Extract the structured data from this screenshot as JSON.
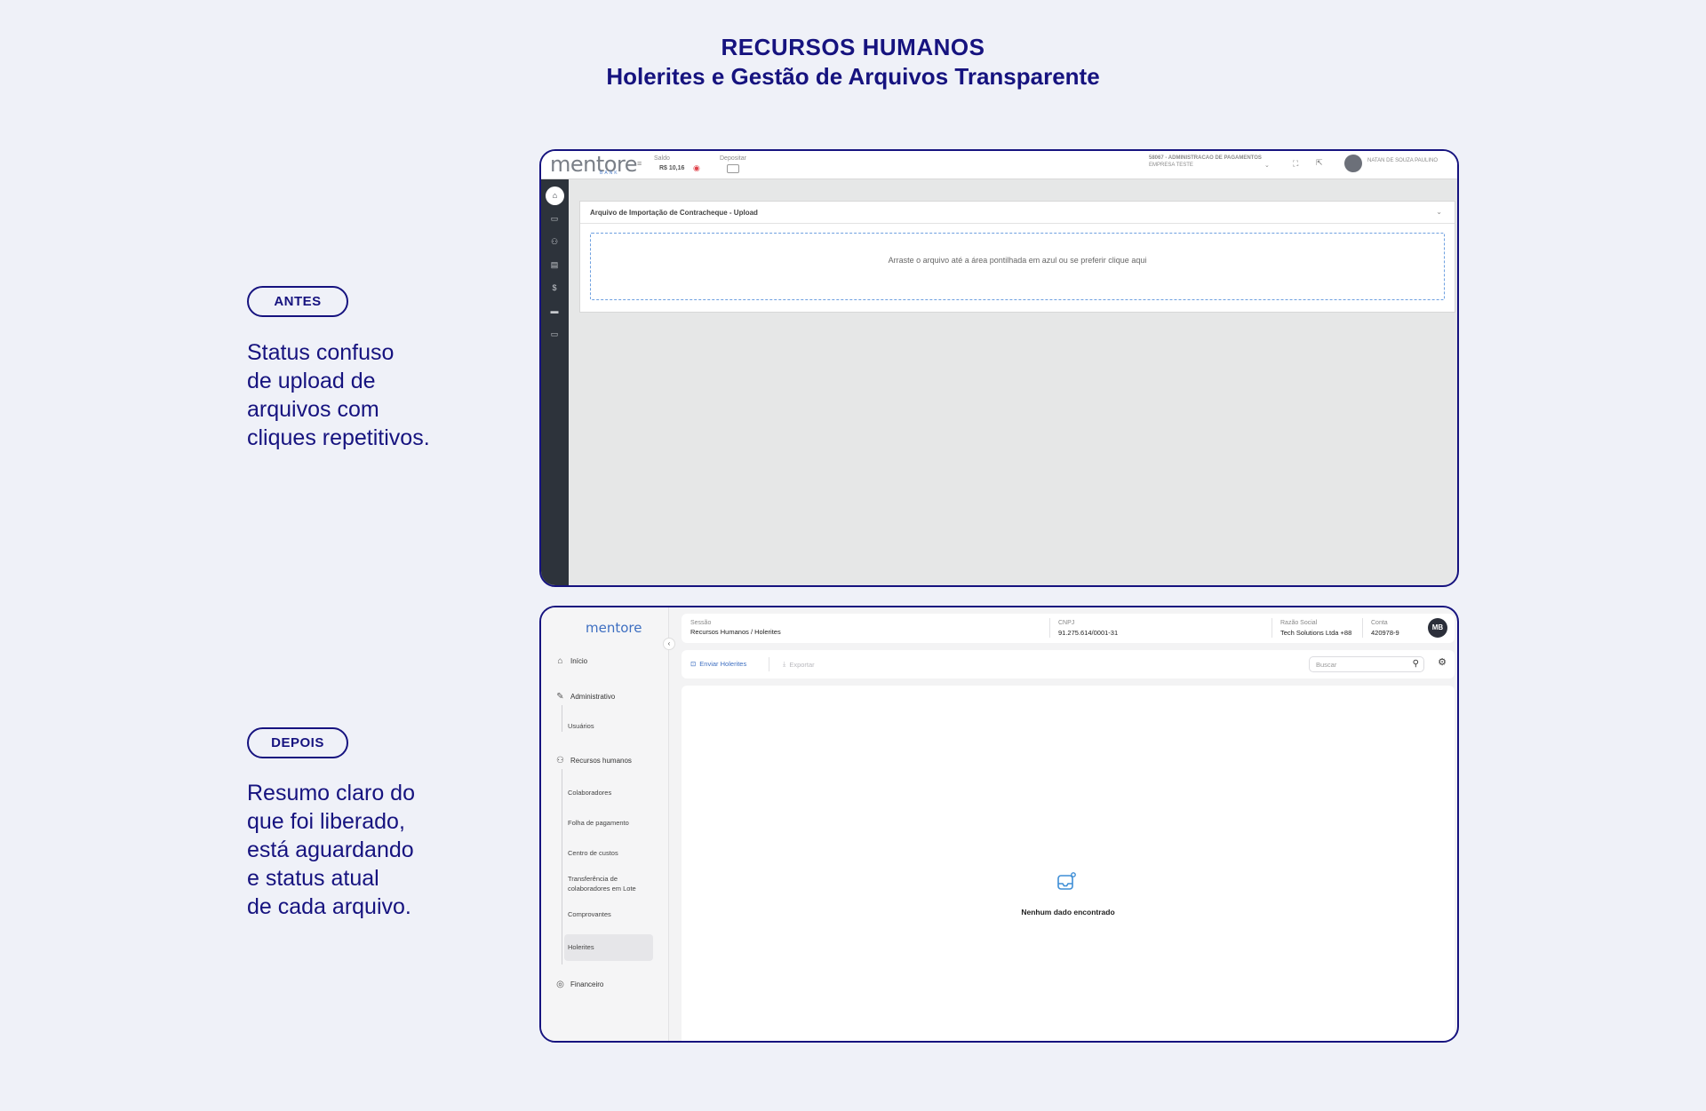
{
  "heading": {
    "title": "RECURSOS HUMANOS",
    "subtitle": "Holerites e Gestão de Arquivos Transparente"
  },
  "before": {
    "pill": "ANTES",
    "description": "Status confuso\nde upload de\narquivos com\ncliques repetitivos.",
    "screen": {
      "logo": "mentore",
      "logo_sub": "BANK",
      "saldo_label": "Saldo",
      "saldo_value": "R$ 10,16",
      "depositar_label": "Depositar",
      "company_line1": "58067 - ADMINISTRACAO DE PAGAMENTOS",
      "company_line2": "EMPRESA TESTE",
      "user_name": "NATAN DE SOUZA PAULINO",
      "card_title": "Arquivo de Importação de Contracheque - Upload",
      "dropzone_text": "Arraste o arquivo até a área pontilhada em azul ou se preferir clique aqui"
    }
  },
  "after": {
    "pill": "DEPOIS",
    "description": "Resumo claro do\nque foi liberado,\nestá aguardando\ne status atual\nde cada arquivo.",
    "screen": {
      "logo": "mentore",
      "nav": {
        "inicio": "Início",
        "administrativo": "Administrativo",
        "usuarios": "Usuários",
        "rh": "Recursos humanos",
        "colaboradores": "Colaboradores",
        "folha": "Folha de pagamento",
        "centro": "Centro de custos",
        "transferencia": "Transferência de\ncolaboradores em Lote",
        "comprovantes": "Comprovantes",
        "holerites": "Holerites",
        "financeiro": "Financeiro"
      },
      "header": {
        "sessao_label": "Sessão",
        "sessao_value": "Recursos Humanos / Holerites",
        "cnpj_label": "CNPJ",
        "cnpj_value": "91.275.614/0001-31",
        "razao_label": "Razão Social",
        "razao_value": "Tech Solutions Ltda +88",
        "conta_label": "Conta",
        "conta_value": "420978-9",
        "avatar": "MB"
      },
      "toolbar": {
        "enviar": "Enviar Holerites",
        "exportar": "Exportar",
        "search_placeholder": "Buscar"
      },
      "empty_message": "Nenhum dado encontrado"
    }
  },
  "colors": {
    "brand_navy": "#16137f",
    "background": "#eff1f8",
    "accent_blue": "#3e6fc1",
    "sidebar_dark": "#2d333b"
  }
}
